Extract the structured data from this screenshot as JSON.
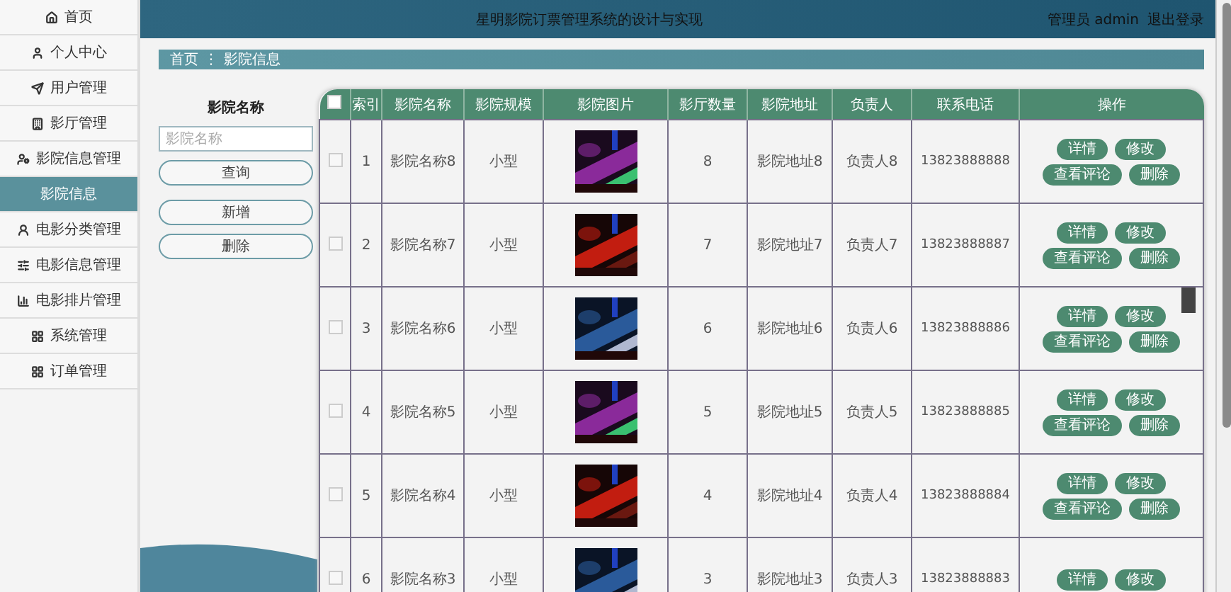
{
  "sidebar": {
    "items": [
      {
        "label": "首页",
        "selected": false
      },
      {
        "label": "个人中心",
        "selected": false
      },
      {
        "label": "用户管理",
        "selected": false
      },
      {
        "label": "影厅管理",
        "selected": false
      },
      {
        "label": "影院信息管理",
        "selected": false,
        "expanded": true,
        "children": [
          {
            "label": "影院信息",
            "selected": true
          }
        ]
      },
      {
        "label": "电影分类管理",
        "selected": false
      },
      {
        "label": "电影信息管理",
        "selected": false
      },
      {
        "label": "电影排片管理",
        "selected": false
      },
      {
        "label": "系统管理",
        "selected": false
      },
      {
        "label": "订单管理",
        "selected": false
      }
    ]
  },
  "header": {
    "title": "星明影院订票管理系统的设计与实现",
    "user": "管理员 admin",
    "logout": "退出登录"
  },
  "breadcrumb": [
    "首页",
    "影院信息"
  ],
  "breadcrumb_separator": "⋮",
  "search": {
    "label": "影院名称",
    "placeholder": "影院名称",
    "buttons": [
      "查询",
      "新增",
      "删除"
    ]
  },
  "table": {
    "header_checked": false,
    "columns": [
      "索引",
      "影院名称",
      "影院规模",
      "影院图片",
      "影厅数量",
      "影院地址",
      "负责人",
      "联系电话",
      "操作"
    ],
    "rows": [
      {
        "checked": false,
        "cells": [
          "1",
          "影院名称8",
          "小型",
          {
            "kind": "picture"
          },
          "8",
          "影院地址8",
          "负责人8",
          "13823888888"
        ],
        "actions": [
          "详情",
          "修改",
          "查看评论",
          "删除"
        ]
      },
      {
        "checked": false,
        "cells": [
          "2",
          "影院名称7",
          "小型",
          {
            "kind": "picture"
          },
          "7",
          "影院地址7",
          "负责人7",
          "13823888887"
        ],
        "actions": [
          "详情",
          "修改",
          "查看评论",
          "删除"
        ]
      },
      {
        "checked": false,
        "cells": [
          "3",
          "影院名称6",
          "小型",
          {
            "kind": "picture"
          },
          "6",
          "影院地址6",
          "负责人6",
          "13823888886"
        ],
        "actions": [
          "详情",
          "修改",
          "查看评论",
          "删除"
        ]
      },
      {
        "checked": false,
        "cells": [
          "4",
          "影院名称5",
          "小型",
          {
            "kind": "picture"
          },
          "5",
          "影院地址5",
          "负责人5",
          "13823888885"
        ],
        "actions": [
          "详情",
          "修改",
          "查看评论",
          "删除"
        ]
      },
      {
        "checked": false,
        "cells": [
          "5",
          "影院名称4",
          "小型",
          {
            "kind": "picture"
          },
          "4",
          "影院地址4",
          "负责人4",
          "13823888884"
        ],
        "actions": [
          "详情",
          "修改",
          "查看评论",
          "删除"
        ]
      },
      {
        "checked": false,
        "cells": [
          "6",
          "影院名称3",
          "小型",
          {
            "kind": "picture"
          },
          "3",
          "影院地址3",
          "负责人3",
          "13823888883"
        ],
        "actions": [
          "详情",
          "修改"
        ]
      }
    ]
  }
}
